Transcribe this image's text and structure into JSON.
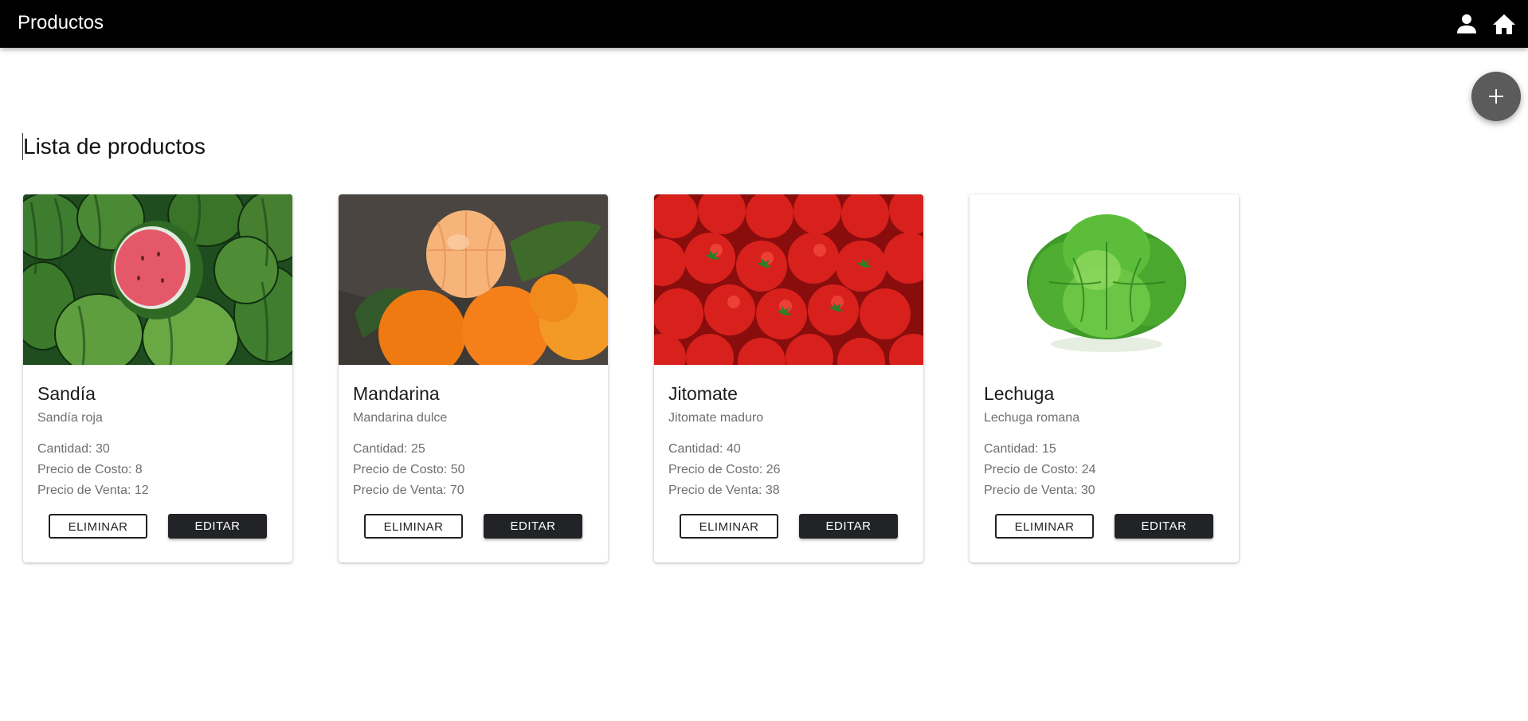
{
  "header": {
    "title": "Productos",
    "icons": [
      "user-icon",
      "home-icon"
    ],
    "background": "#000000"
  },
  "fab": {
    "icon": "plus-icon",
    "color": "#5b5b5b"
  },
  "page": {
    "heading": "Lista de productos"
  },
  "labels": {
    "delete": "ELIMINAR",
    "edit": "EDITAR"
  },
  "products": [
    {
      "name": "Sandía",
      "description": "Sandía roja",
      "quantity_text": "Cantidad: 30",
      "cost_text": "Precio de Costo: 8",
      "sale_text": "Precio de Venta: 12",
      "image": "watermelons"
    },
    {
      "name": "Mandarina",
      "description": "Mandarina dulce",
      "quantity_text": "Cantidad: 25",
      "cost_text": "Precio de Costo: 50",
      "sale_text": "Precio de Venta: 70",
      "image": "mandarins"
    },
    {
      "name": "Jitomate",
      "description": "Jitomate maduro",
      "quantity_text": "Cantidad: 40",
      "cost_text": "Precio de Costo: 26",
      "sale_text": "Precio de Venta: 38",
      "image": "tomatoes"
    },
    {
      "name": "Lechuga",
      "description": "Lechuga romana",
      "quantity_text": "Cantidad: 15",
      "cost_text": "Precio de Costo: 24",
      "sale_text": "Precio de Venta: 30",
      "image": "lettuce"
    }
  ]
}
